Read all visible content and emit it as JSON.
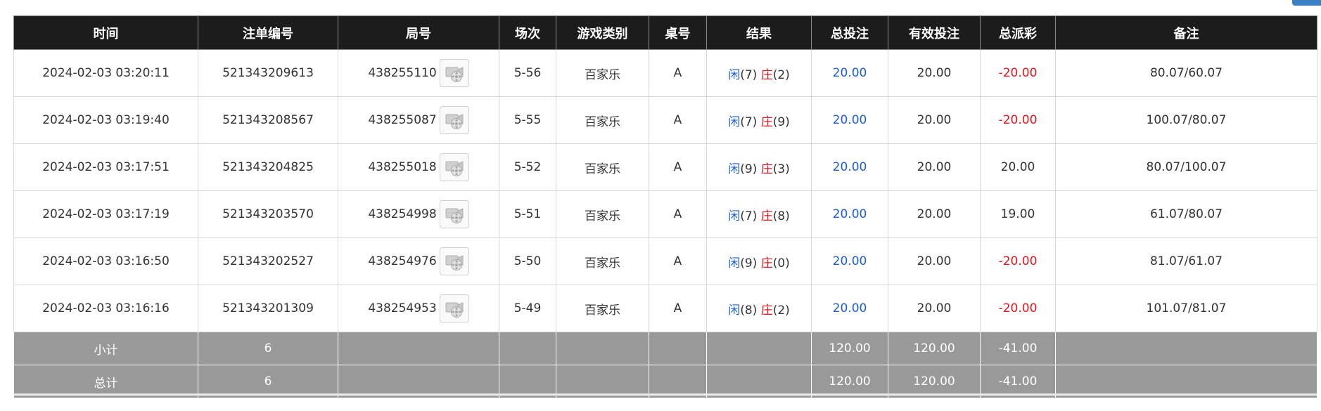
{
  "table": {
    "headers": [
      "时间",
      "注单编号",
      "局号",
      "场次",
      "游戏类别",
      "桌号",
      "结果",
      "总投注",
      "有效投注",
      "总派彩",
      "备注"
    ],
    "rows": [
      {
        "time": "2024-02-03 03:20:11",
        "order_no": "521343209613",
        "round_no": "438255110",
        "session": "5-56",
        "game_type": "百家乐",
        "table_no": "A",
        "player_label": "闲",
        "player_points": "(7)",
        "banker_label": "庄",
        "banker_points": "(2)",
        "total_bet": "20.00",
        "valid_bet": "20.00",
        "payout": "-20.00",
        "remark": "80.07/60.07"
      },
      {
        "time": "2024-02-03 03:19:40",
        "order_no": "521343208567",
        "round_no": "438255087",
        "session": "5-55",
        "game_type": "百家乐",
        "table_no": "A",
        "player_label": "闲",
        "player_points": "(7)",
        "banker_label": "庄",
        "banker_points": "(9)",
        "total_bet": "20.00",
        "valid_bet": "20.00",
        "payout": "-20.00",
        "remark": "100.07/80.07"
      },
      {
        "time": "2024-02-03 03:17:51",
        "order_no": "521343204825",
        "round_no": "438255018",
        "session": "5-52",
        "game_type": "百家乐",
        "table_no": "A",
        "player_label": "闲",
        "player_points": "(9)",
        "banker_label": "庄",
        "banker_points": "(3)",
        "total_bet": "20.00",
        "valid_bet": "20.00",
        "payout": "20.00",
        "remark": "80.07/100.07"
      },
      {
        "time": "2024-02-03 03:17:19",
        "order_no": "521343203570",
        "round_no": "438254998",
        "session": "5-51",
        "game_type": "百家乐",
        "table_no": "A",
        "player_label": "闲",
        "player_points": "(7)",
        "banker_label": "庄",
        "banker_points": "(8)",
        "total_bet": "20.00",
        "valid_bet": "20.00",
        "payout": "19.00",
        "remark": "61.07/80.07"
      },
      {
        "time": "2024-02-03 03:16:50",
        "order_no": "521343202527",
        "round_no": "438254976",
        "session": "5-50",
        "game_type": "百家乐",
        "table_no": "A",
        "player_label": "闲",
        "player_points": "(9)",
        "banker_label": "庄",
        "banker_points": "(0)",
        "total_bet": "20.00",
        "valid_bet": "20.00",
        "payout": "-20.00",
        "remark": "81.07/61.07"
      },
      {
        "time": "2024-02-03 03:16:16",
        "order_no": "521343201309",
        "round_no": "438254953",
        "session": "5-49",
        "game_type": "百家乐",
        "table_no": "A",
        "player_label": "闲",
        "player_points": "(8)",
        "banker_label": "庄",
        "banker_points": "(2)",
        "total_bet": "20.00",
        "valid_bet": "20.00",
        "payout": "-20.00",
        "remark": "101.07/81.07"
      }
    ],
    "subtotal": {
      "label": "小计",
      "count": "6",
      "total_bet": "120.00",
      "valid_bet": "120.00",
      "payout": "-41.00"
    },
    "grand_total": {
      "label": "总计",
      "count": "6",
      "total_bet": "120.00",
      "valid_bet": "120.00",
      "payout": "-41.00"
    }
  },
  "icons": {
    "replay": "video-replay-icon"
  },
  "colors": {
    "header_bg": "#1c1c1c",
    "summary_bg": "#999999",
    "positive_blue": "#1e5fd6",
    "negative_red": "#e8141b"
  }
}
